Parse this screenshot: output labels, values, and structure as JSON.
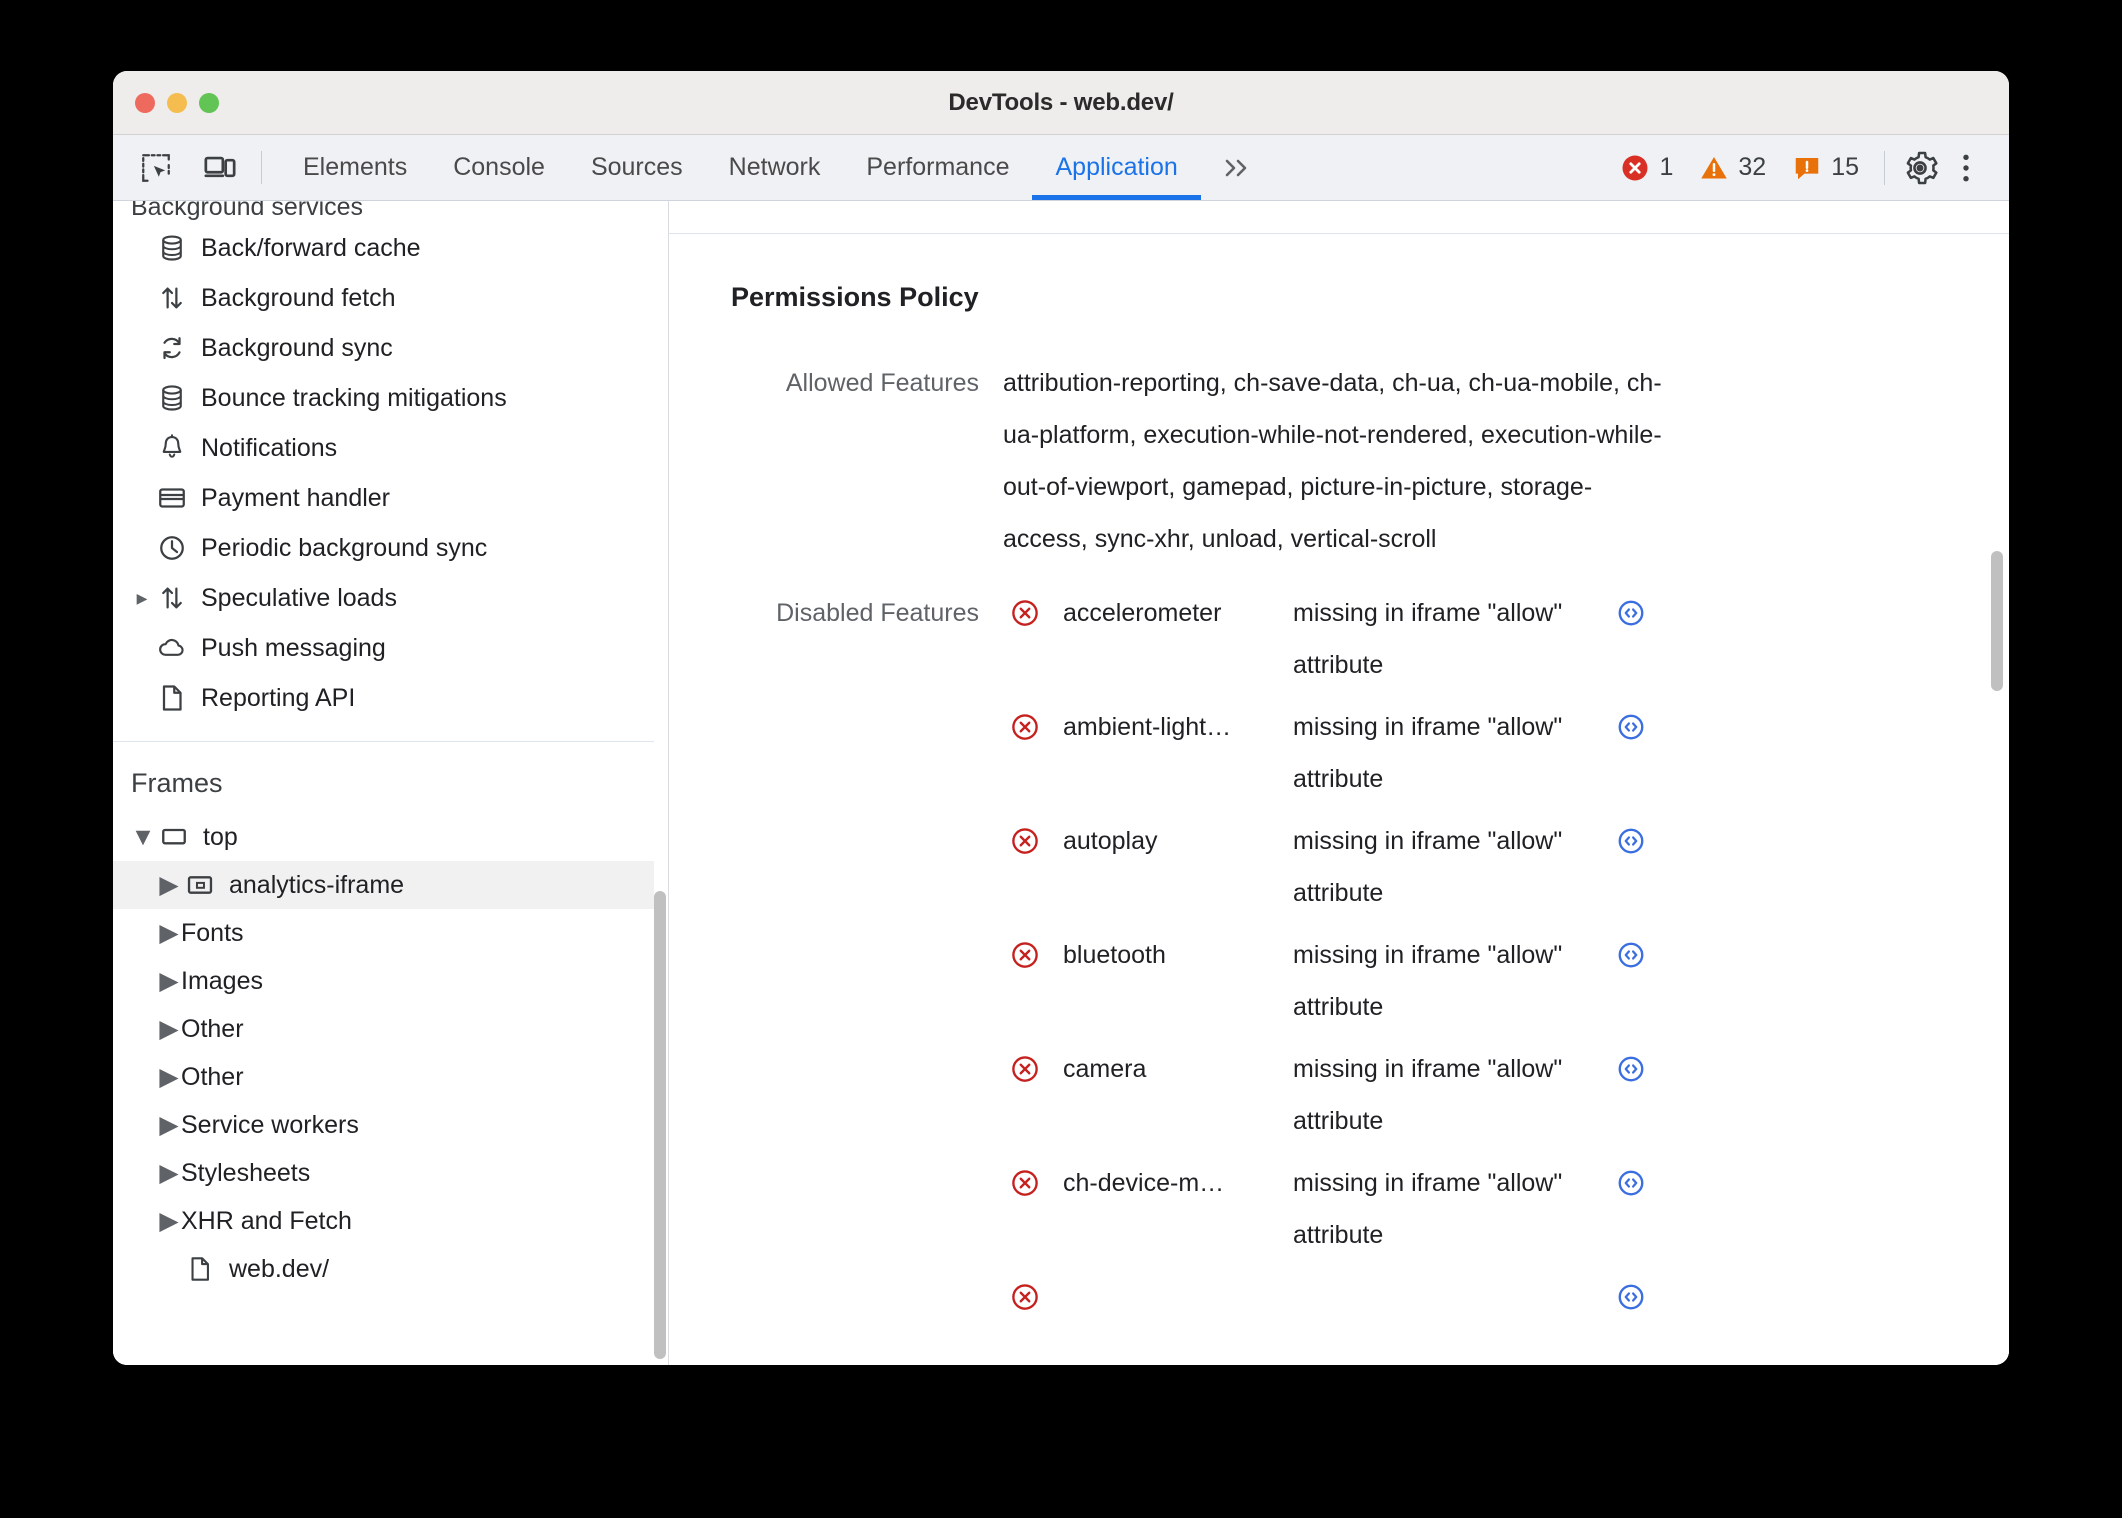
{
  "window": {
    "title": "DevTools - web.dev/",
    "traffic_lights": [
      "close-button",
      "minimize-button",
      "maximize-button"
    ]
  },
  "toolbar": {
    "inspect_icon": "inspect-element-icon",
    "device_icon": "device-toolbar-icon",
    "tabs": [
      {
        "label": "Elements",
        "active": false
      },
      {
        "label": "Console",
        "active": false
      },
      {
        "label": "Sources",
        "active": false
      },
      {
        "label": "Network",
        "active": false
      },
      {
        "label": "Performance",
        "active": false
      },
      {
        "label": "Application",
        "active": true
      }
    ],
    "more_tabs_label": "»",
    "status": {
      "errors": "1",
      "warnings": "32",
      "issues": "15"
    },
    "settings_icon": "gear-icon",
    "menu_icon": "kebab-menu-icon",
    "accent_color": "#1a73e8",
    "error_color": "#d93025",
    "warning_color": "#e8710a"
  },
  "sidebar": {
    "background_services": {
      "title": "Background services",
      "items": [
        {
          "label": "Back/forward cache",
          "icon": "database-icon",
          "expandable": false
        },
        {
          "label": "Background fetch",
          "icon": "arrows-up-down-icon",
          "expandable": false
        },
        {
          "label": "Background sync",
          "icon": "sync-icon",
          "expandable": false
        },
        {
          "label": "Bounce tracking mitigations",
          "icon": "database-icon",
          "expandable": false
        },
        {
          "label": "Notifications",
          "icon": "bell-icon",
          "expandable": false
        },
        {
          "label": "Payment handler",
          "icon": "credit-card-icon",
          "expandable": false
        },
        {
          "label": "Periodic background sync",
          "icon": "clock-icon",
          "expandable": false
        },
        {
          "label": "Speculative loads",
          "icon": "arrows-up-down-icon",
          "expandable": true
        },
        {
          "label": "Push messaging",
          "icon": "cloud-icon",
          "expandable": false
        },
        {
          "label": "Reporting API",
          "icon": "document-icon",
          "expandable": false
        }
      ]
    },
    "frames": {
      "title": "Frames",
      "tree": [
        {
          "label": "top",
          "icon": "frame-icon",
          "indent": 0,
          "expanded": true,
          "expandable": true,
          "selected": false
        },
        {
          "label": "analytics-iframe",
          "icon": "iframe-icon",
          "indent": 1,
          "expanded": false,
          "expandable": true,
          "selected": true
        },
        {
          "label": "Fonts",
          "icon": "",
          "indent": 1,
          "expanded": false,
          "expandable": true,
          "selected": false
        },
        {
          "label": "Images",
          "icon": "",
          "indent": 1,
          "expanded": false,
          "expandable": true,
          "selected": false
        },
        {
          "label": "Other",
          "icon": "",
          "indent": 1,
          "expanded": false,
          "expandable": true,
          "selected": false
        },
        {
          "label": "Other",
          "icon": "",
          "indent": 1,
          "expanded": false,
          "expandable": true,
          "selected": false
        },
        {
          "label": "Service workers",
          "icon": "",
          "indent": 1,
          "expanded": false,
          "expandable": true,
          "selected": false
        },
        {
          "label": "Stylesheets",
          "icon": "",
          "indent": 1,
          "expanded": false,
          "expandable": true,
          "selected": false
        },
        {
          "label": "XHR and Fetch",
          "icon": "",
          "indent": 1,
          "expanded": false,
          "expandable": true,
          "selected": false
        },
        {
          "label": "web.dev/",
          "icon": "document-icon",
          "indent": 1,
          "expanded": false,
          "expandable": false,
          "selected": false
        }
      ]
    }
  },
  "main": {
    "report_title": "Permissions Policy",
    "allowed": {
      "label": "Allowed Features",
      "value": "attribution-reporting, ch-save-data, ch-ua, ch-ua-mobile, ch-ua-platform, execution-while-not-rendered, execution-while-out-of-viewport, gamepad, picture-in-picture, storage-access, sync-xhr, unload, vertical-scroll"
    },
    "disabled": {
      "label": "Disabled Features",
      "rows": [
        {
          "name": "accelerometer",
          "reason": "missing in iframe \"allow\" attribute",
          "status_icon": "error-circle-x-icon",
          "link_icon": "code-circle-icon"
        },
        {
          "name": "ambient-light…",
          "reason": "missing in iframe \"allow\" attribute",
          "status_icon": "error-circle-x-icon",
          "link_icon": "code-circle-icon"
        },
        {
          "name": "autoplay",
          "reason": "missing in iframe \"allow\" attribute",
          "status_icon": "error-circle-x-icon",
          "link_icon": "code-circle-icon"
        },
        {
          "name": "bluetooth",
          "reason": "missing in iframe \"allow\" attribute",
          "status_icon": "error-circle-x-icon",
          "link_icon": "code-circle-icon"
        },
        {
          "name": "camera",
          "reason": "missing in iframe \"allow\" attribute",
          "status_icon": "error-circle-x-icon",
          "link_icon": "code-circle-icon"
        },
        {
          "name": "ch-device-m…",
          "reason": "missing in iframe \"allow\" attribute",
          "status_icon": "error-circle-x-icon",
          "link_icon": "code-circle-icon"
        },
        {
          "name": "",
          "reason": "",
          "status_icon": "error-circle-x-icon",
          "link_icon": "code-circle-icon"
        }
      ]
    },
    "link_color": "#3b6fe0",
    "error_color": "#c5221f"
  }
}
